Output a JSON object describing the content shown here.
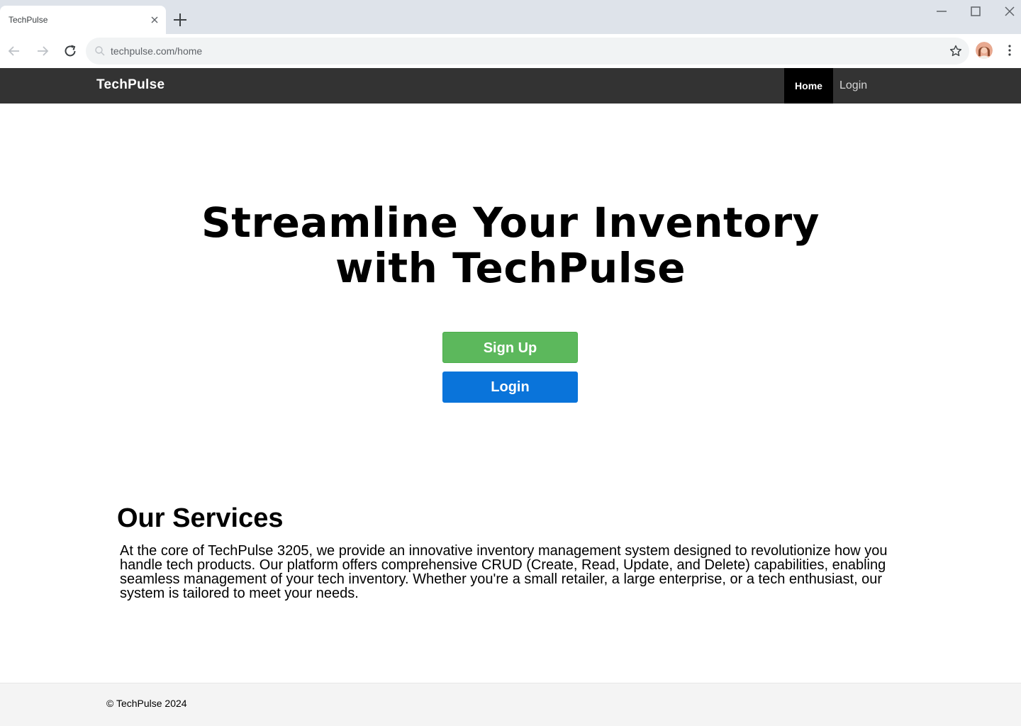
{
  "browser": {
    "tab_title": "TechPulse",
    "url": "techpulse.com/home",
    "icons": {
      "tab_close": "close-icon",
      "new_tab": "plus-icon",
      "minimize": "minimize-icon",
      "maximize": "maximize-icon",
      "close_window": "close-icon",
      "back": "arrow-left-icon",
      "forward": "arrow-right-icon",
      "reload": "reload-icon",
      "search": "search-icon",
      "bookmark": "star-icon",
      "menu": "kebab-icon"
    }
  },
  "nav": {
    "brand": "TechPulse",
    "items": [
      {
        "label": "Home",
        "active": true
      },
      {
        "label": "Login",
        "active": false
      }
    ],
    "background": "#333333"
  },
  "hero": {
    "title_line1": "Streamline Your Inventory",
    "title_line2": "with TechPulse",
    "signup_label": "Sign Up",
    "login_label": "Login",
    "signup_color": "#5cb85c",
    "login_color": "#0a74da"
  },
  "services": {
    "title": "Our Services",
    "text": "At the core of TechPulse 3205, we provide an innovative inventory management system designed to revolutionize how you handle tech products. Our platform offers comprehensive CRUD (Create, Read, Update, and Delete) capabilities, enabling seamless management of your tech inventory. Whether you're a small retailer, a large enterprise, or a tech enthusiast, our system is tailored to meet your needs."
  },
  "footer": {
    "text": "© TechPulse 2024"
  }
}
